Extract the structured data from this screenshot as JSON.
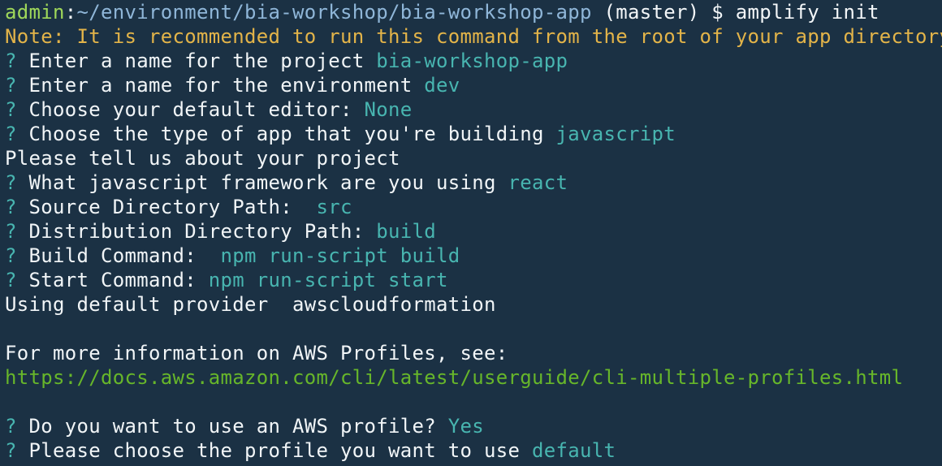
{
  "terminal": {
    "prompt": {
      "user": "admin",
      "sep": ":",
      "path": "~/environment/bia-workshop/bia-workshop-app",
      "branch": " (master) $ ",
      "command": "amplify init"
    },
    "note": "Note: It is recommended to run this command from the root of your app directory",
    "lines": [
      {
        "q": "? ",
        "label": "Enter a name for the project ",
        "answer": "bia-workshop-app"
      },
      {
        "q": "? ",
        "label": "Enter a name for the environment ",
        "answer": "dev"
      },
      {
        "q": "? ",
        "label": "Choose your default editor: ",
        "answer": "None"
      },
      {
        "q": "? ",
        "label": "Choose the type of app that you're building ",
        "answer": "javascript"
      }
    ],
    "tell_us": "Please tell us about your project",
    "lines2": [
      {
        "q": "? ",
        "label": "What javascript framework are you using ",
        "answer": "react"
      },
      {
        "q": "? ",
        "label": "Source Directory Path:  ",
        "answer": "src"
      },
      {
        "q": "? ",
        "label": "Distribution Directory Path: ",
        "answer": "build"
      },
      {
        "q": "? ",
        "label": "Build Command:  ",
        "answer": "npm run-script build"
      },
      {
        "q": "? ",
        "label": "Start Command: ",
        "answer": "npm run-script start"
      }
    ],
    "provider": "Using default provider  awscloudformation",
    "info": "For more information on AWS Profiles, see:",
    "link": "https://docs.aws.amazon.com/cli/latest/userguide/cli-multiple-profiles.html",
    "lines3": [
      {
        "q": "? ",
        "label": "Do you want to use an AWS profile? ",
        "answer": "Yes"
      },
      {
        "q": "? ",
        "label": "Please choose the profile you want to use ",
        "answer": "default"
      }
    ]
  }
}
